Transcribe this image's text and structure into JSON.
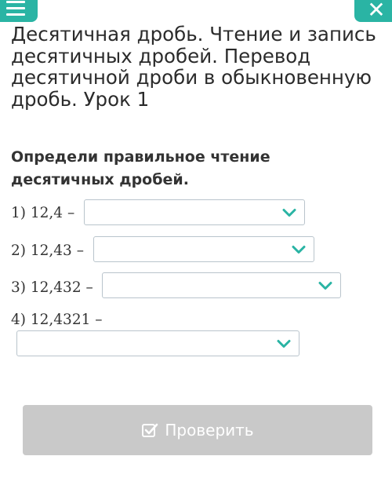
{
  "title": "Десятичная дробь. Чтение и запись десятичных дробей. Перевод десятичной дроби в обыкновенную дробь. Урок 1",
  "question": "Определи правильное чтение десятичных дробей.",
  "items": [
    {
      "label": "1) 12,4 –",
      "selected": ""
    },
    {
      "label": "2) 12,43 –",
      "selected": ""
    },
    {
      "label": "3) 12,432 –",
      "selected": ""
    },
    {
      "label": "4) 12,4321 –",
      "selected": ""
    }
  ],
  "check_button": {
    "label": "Проверить",
    "icon": "checkbox-check-icon"
  },
  "top_bar": {
    "menu_icon": "hamburger-menu-icon",
    "close_icon": "close-icon"
  },
  "colors": {
    "accent": "#2ab4a4",
    "button_disabled": "#c9c9c9",
    "chevron": "#2ab4a4",
    "select_border": "#b9c4cc"
  }
}
